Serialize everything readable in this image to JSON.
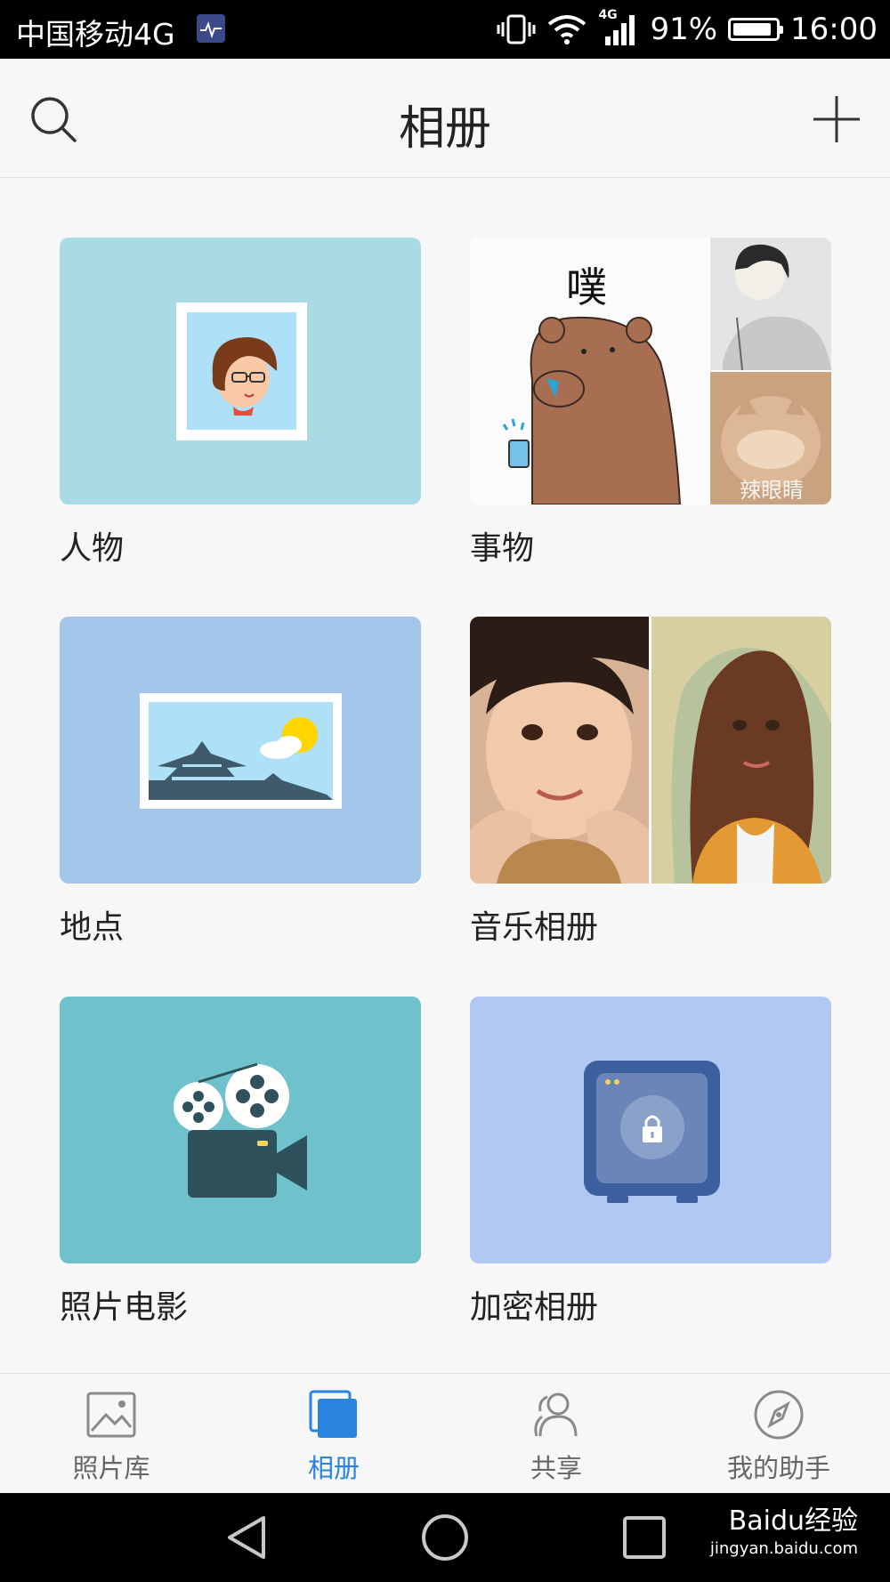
{
  "status_bar": {
    "carrier": "中国移动4G",
    "network_badge": "4G",
    "battery": "91%",
    "battery_level": 0.91,
    "time": "16:00"
  },
  "title_bar": {
    "title": "相册"
  },
  "albums": [
    {
      "label": "人物",
      "thumb_icon": "person-portrait-icon"
    },
    {
      "label": "事物",
      "thumb_icon": "things-collage",
      "caption_text": "噗",
      "overlay_text": "辣眼睛"
    },
    {
      "label": "地点",
      "thumb_icon": "landscape-pagoda-icon"
    },
    {
      "label": "音乐相册",
      "thumb_icon": "music-photo-collage"
    },
    {
      "label": "照片电影",
      "thumb_icon": "film-projector-icon"
    },
    {
      "label": "加密相册",
      "thumb_icon": "safe-lock-icon"
    }
  ],
  "bottom_nav": {
    "items": [
      {
        "label": "照片库",
        "icon": "photo-library-icon",
        "active": false
      },
      {
        "label": "相册",
        "icon": "albums-icon",
        "active": true
      },
      {
        "label": "共享",
        "icon": "share-people-icon",
        "active": false
      },
      {
        "label": "我的助手",
        "icon": "compass-icon",
        "active": false
      }
    ],
    "active_color": "#2b83e0",
    "inactive_color": "#666666"
  },
  "watermark": {
    "brand": "Baidu经验",
    "url": "jingyan.baidu.com"
  }
}
